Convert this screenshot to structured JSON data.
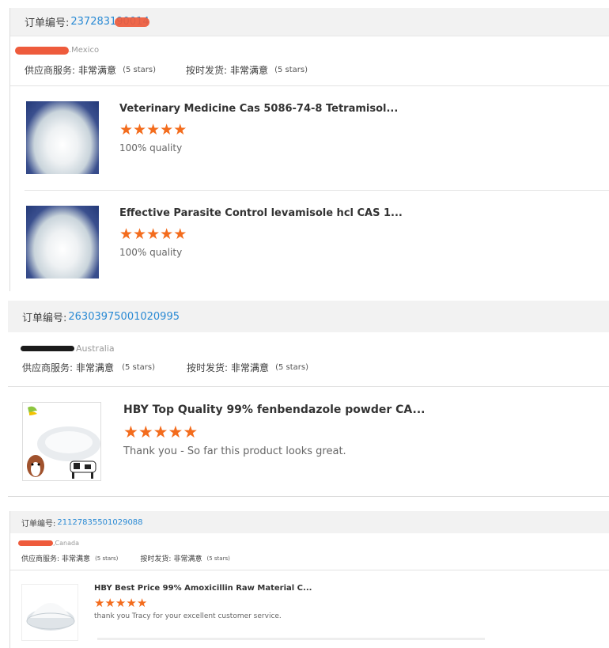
{
  "orders": [
    {
      "order_label": "订单编号:",
      "order_number": "237283190014",
      "buyer": ".Mexico",
      "supplier_service_label": "供应商服务:",
      "supplier_service_value": "非常满意",
      "supplier_service_stars": "(5 stars)",
      "ontime_label": "按时发货:",
      "ontime_value": "非常满意",
      "ontime_stars": "(5 stars)",
      "items": [
        {
          "title": "Veterinary Medicine Cas 5086-74-8 Tetramisol...",
          "rating": 5,
          "review": "100% quality"
        },
        {
          "title": "Effective Parasite Control levamisole hcl CAS 1...",
          "rating": 5,
          "review": "100% quality"
        }
      ]
    },
    {
      "order_label": "订单编号:",
      "order_number": "26303975001020995",
      "buyer": "Australia",
      "supplier_service_label": "供应商服务:",
      "supplier_service_value": "非常满意",
      "supplier_service_stars": "(5 stars)",
      "ontime_label": "按时发货:",
      "ontime_value": "非常满意",
      "ontime_stars": "(5 stars)",
      "items": [
        {
          "title": "HBY Top Quality 99% fenbendazole powder CA...",
          "rating": 5,
          "review": "Thank you - So far this product looks great."
        }
      ]
    },
    {
      "order_label": "订单编号:",
      "order_number": "21127835501029088",
      "buyer": ",Canada",
      "supplier_service_label": "供应商服务:",
      "supplier_service_value": "非常满意",
      "supplier_service_stars": "(5 stars)",
      "ontime_label": "按时发货:",
      "ontime_value": "非常满意",
      "ontime_stars": "(5 stars)",
      "items": [
        {
          "title": "HBY Best Price 99% Amoxicillin Raw Material C...",
          "rating": 5,
          "review": "thank you Tracy for your excellent customer service."
        }
      ]
    }
  ],
  "colors": {
    "order_number": "#2a8ad4",
    "star": "#f36c1d",
    "redaction": "#ee5b3c",
    "header_bg": "#f2f2f2"
  },
  "icons": {
    "star": "star-icon"
  }
}
